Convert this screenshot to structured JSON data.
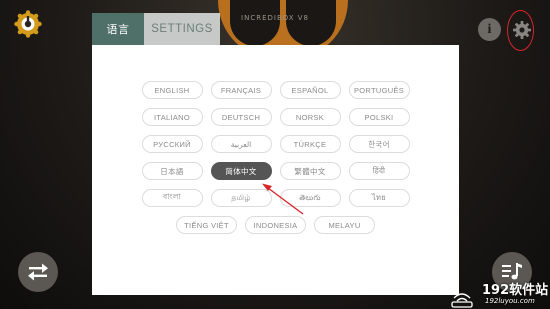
{
  "app": {
    "title": "INCREDIBOX V8"
  },
  "tabs": [
    {
      "label": "语言",
      "active": true
    },
    {
      "label": "SETTINGS",
      "active": false
    }
  ],
  "languages": {
    "rows": [
      [
        "ENGLISH",
        "FRANÇAIS",
        "ESPAÑOL",
        "PORTUGUÊS"
      ],
      [
        "ITALIANO",
        "DEUTSCH",
        "NORSK",
        "POLSKI"
      ],
      [
        "РУССКИЙ",
        "العربية",
        "TÜRKÇE",
        "한국어"
      ],
      [
        "日本語",
        "简体中文",
        "繁體中文",
        "हिंदी"
      ],
      [
        "বাংলা",
        "தமிழ்",
        "తెలుగు",
        "ไทย"
      ],
      [
        "TIẾNG VIỆT",
        "INDONESIA",
        "MELAYU"
      ]
    ],
    "selected": "简体中文"
  },
  "icons": {
    "logo": "incredibox-logo-icon",
    "info": "info-icon",
    "settings": "gear-icon",
    "swap": "swap-arrows-icon",
    "music": "music-list-icon"
  },
  "info_label": "i",
  "watermark": {
    "main": "192软件站",
    "sub": "192luyou.com"
  },
  "colors": {
    "accent": "#4f7068",
    "selected": "#555555",
    "annotation": "#d8262b",
    "logo": "#d49a1e"
  }
}
